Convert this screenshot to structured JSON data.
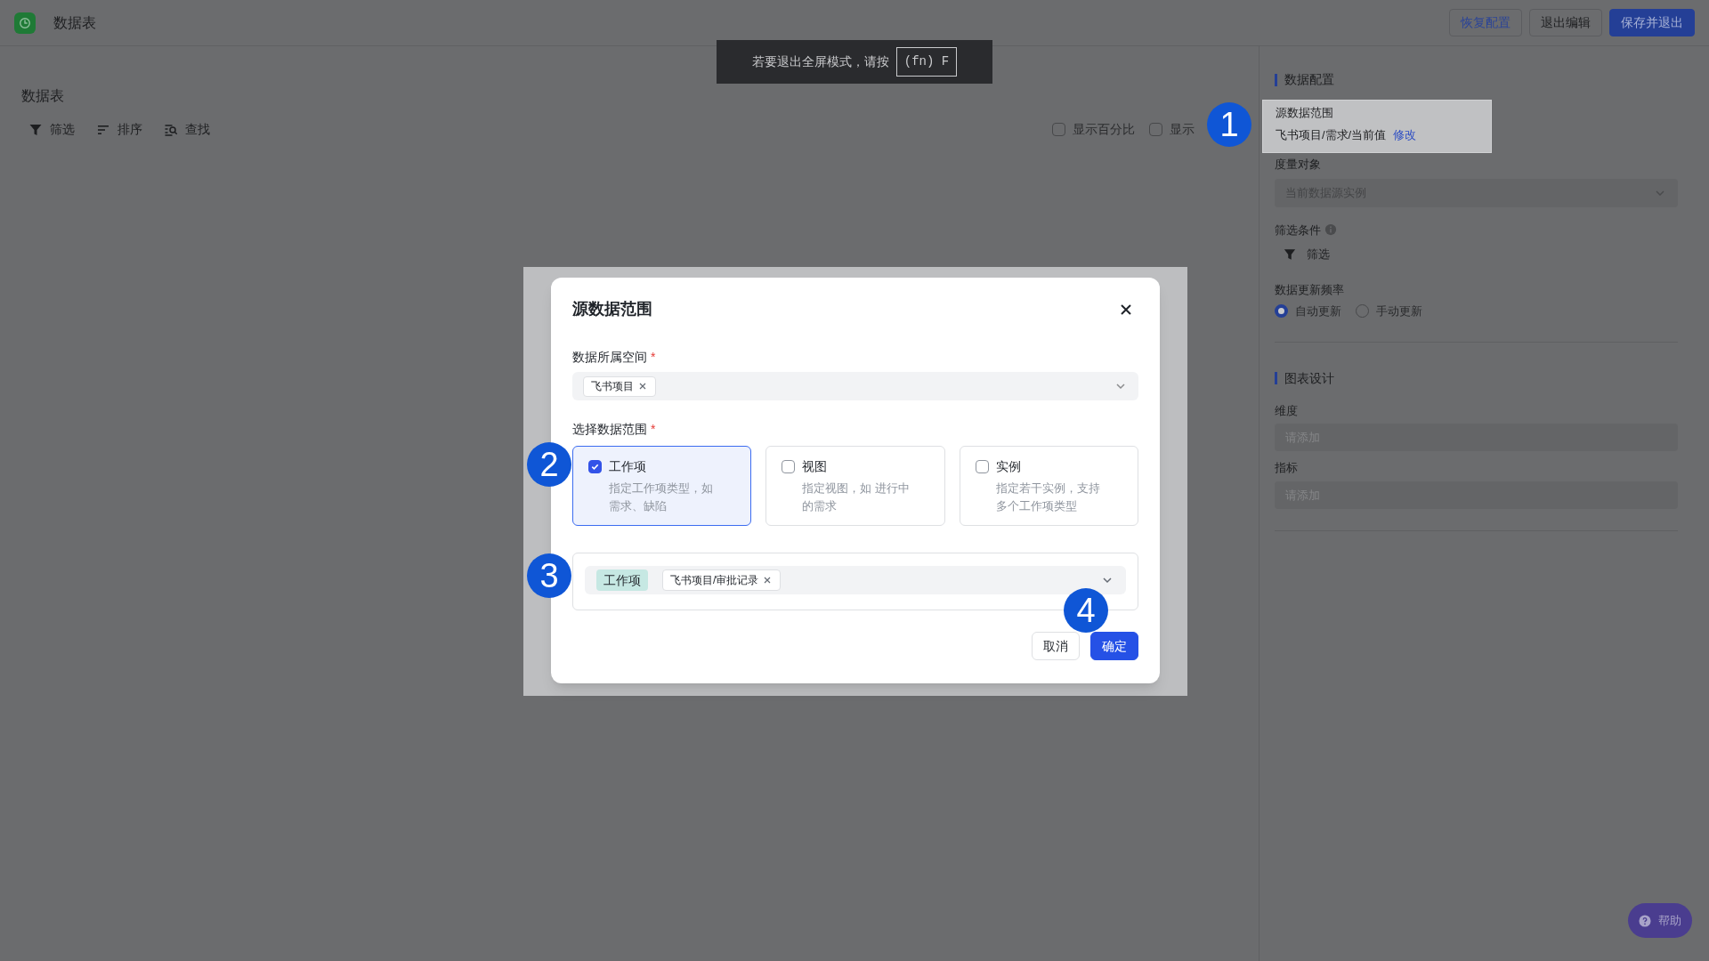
{
  "app": {
    "title": "数据表"
  },
  "header_buttons": [
    {
      "label": "恢复配置",
      "kind": "secondary"
    },
    {
      "label": "退出编辑",
      "kind": "default"
    },
    {
      "label": "保存并退出",
      "kind": "primary"
    }
  ],
  "fullscreen_hint": {
    "text": "若要退出全屏模式，请按",
    "key": "(fn) F"
  },
  "main": {
    "title": "数据表",
    "toolbar": [
      {
        "label": "筛选",
        "kind": "filter"
      },
      {
        "label": "排序",
        "kind": "sort"
      },
      {
        "label": "查找",
        "kind": "find"
      }
    ],
    "options": [
      {
        "label": "显示百分比",
        "checked": false
      },
      {
        "label": "显示",
        "checked": false
      }
    ]
  },
  "data_config": {
    "title": "数据配置",
    "source_range": {
      "label": "源数据范围",
      "value": "飞书项目/需求/当前值",
      "link": "修改",
      "highlighted": true
    },
    "measure": {
      "label": "度量对象",
      "value": "当前数据源实例"
    },
    "filter": {
      "label": "筛选条件",
      "button": "筛选"
    },
    "update_frequency": {
      "label": "数据更新频率",
      "options": [
        {
          "label": "自动更新",
          "selected": true
        },
        {
          "label": "手动更新",
          "selected": false
        }
      ]
    }
  },
  "chart_design": {
    "title": "图表设计",
    "fields": [
      {
        "label": "维度",
        "placeholder": "请添加"
      },
      {
        "label": "指标",
        "placeholder": "请添加"
      }
    ]
  },
  "dialog": {
    "title": "源数据范围",
    "space": {
      "label": "数据所属空间",
      "required_mark": "*",
      "tags": [
        "飞书项目"
      ]
    },
    "scope": {
      "label": "选择数据范围",
      "required_mark": "*",
      "options": [
        {
          "title": "工作项",
          "description": "指定工作项类型，如需求、缺陷",
          "selected": true
        },
        {
          "title": "视图",
          "description": "指定视图，如 进行中的需求",
          "selected": false
        },
        {
          "title": "实例",
          "description": "指定若干实例，支持多个工作项类型",
          "selected": false
        }
      ]
    },
    "picker": {
      "type_tag": "工作项",
      "items": [
        "飞书项目/审批记录"
      ]
    },
    "buttons": [
      {
        "label": "取消",
        "kind": "default"
      },
      {
        "label": "确定",
        "kind": "primary"
      }
    ]
  },
  "callouts": [
    "1",
    "2",
    "3",
    "4"
  ],
  "help_button": {
    "label": "帮助"
  }
}
